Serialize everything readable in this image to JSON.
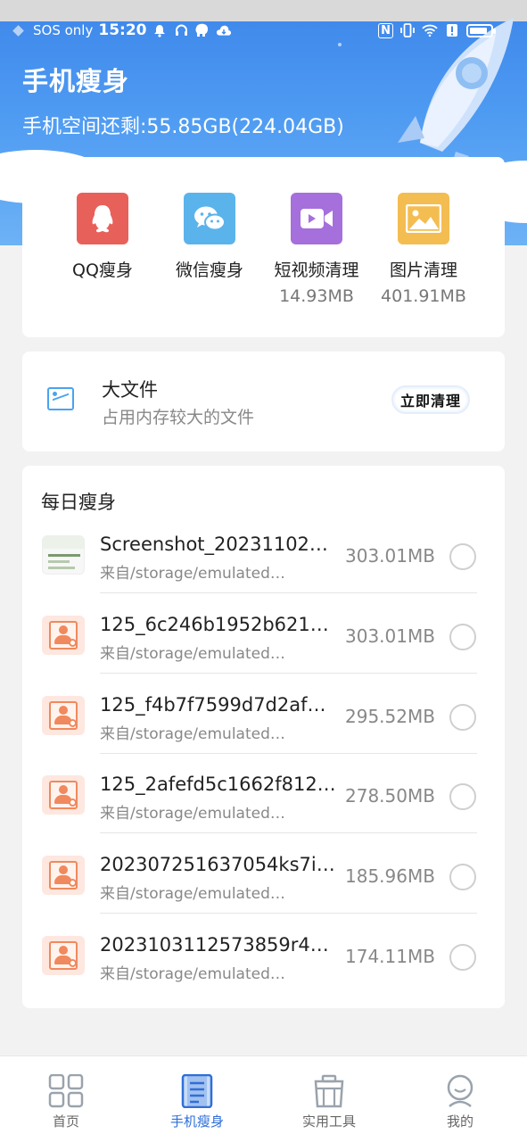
{
  "status_bar": {
    "carrier": "SOS only",
    "time": "15:20",
    "battery_level": 0.85
  },
  "header": {
    "title": "手机瘦身",
    "storage_text": "手机空间还剩:55.85GB(224.04GB)"
  },
  "quick_clean": [
    {
      "label": "QQ瘦身",
      "size": "",
      "icon": "qq-icon",
      "color": "#e8605a"
    },
    {
      "label": "微信瘦身",
      "size": "",
      "icon": "wechat-icon",
      "color": "#5bb3ec"
    },
    {
      "label": "短视频清理",
      "size": "14.93MB",
      "icon": "video-icon",
      "color": "#a56fdc"
    },
    {
      "label": "图片清理",
      "size": "401.91MB",
      "icon": "image-icon",
      "color": "#f4bd52"
    }
  ],
  "big_files": {
    "title": "大文件",
    "subtitle": "占用内存较大的文件",
    "button_label": "立即清理",
    "icon": "picture-icon"
  },
  "daily": {
    "title": "每日瘦身",
    "items": [
      {
        "name": "Screenshot_20231102_…",
        "source": "来自/storage/emulated…",
        "size": "303.01MB",
        "thumb": "screenshot-thumbnail"
      },
      {
        "name": "125_6c246b1952b6219…",
        "source": "来自/storage/emulated…",
        "size": "303.01MB",
        "thumb": "contact-file-icon"
      },
      {
        "name": "125_f4b7f7599d7d2af8…",
        "source": "来自/storage/emulated…",
        "size": "295.52MB",
        "thumb": "contact-file-icon"
      },
      {
        "name": "125_2afefd5c1662f812…",
        "source": "来自/storage/emulated…",
        "size": "278.50MB",
        "thumb": "contact-file-icon"
      },
      {
        "name": "202307251637054ks7i.…",
        "source": "来自/storage/emulated…",
        "size": "185.96MB",
        "thumb": "contact-file-icon"
      },
      {
        "name": "2023103112573859r4y.…",
        "source": "来自/storage/emulated…",
        "size": "174.11MB",
        "thumb": "contact-file-icon"
      }
    ]
  },
  "bottom_nav": [
    {
      "label": "首页",
      "icon": "grid-icon",
      "active": false
    },
    {
      "label": "手机瘦身",
      "icon": "document-icon",
      "active": true
    },
    {
      "label": "实用工具",
      "icon": "toolbox-icon",
      "active": false
    },
    {
      "label": "我的",
      "icon": "profile-icon",
      "active": false
    }
  ],
  "colors": {
    "accent": "#2f6fd8",
    "header_top": "#3d86ea",
    "header_bottom": "#6db2f6"
  }
}
